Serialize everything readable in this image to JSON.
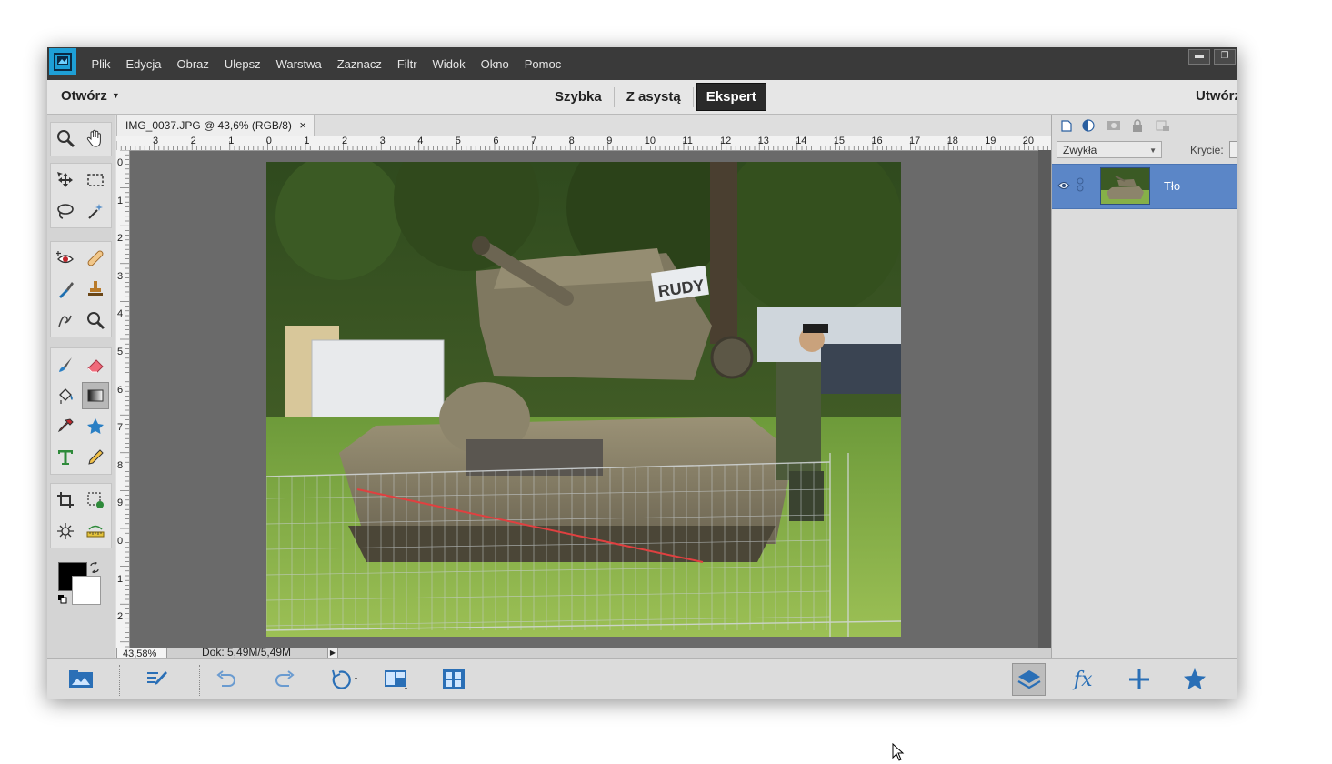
{
  "menu": {
    "items": [
      "Plik",
      "Edycja",
      "Obraz",
      "Ulepsz",
      "Warstwa",
      "Zaznacz",
      "Filtr",
      "Widok",
      "Okno",
      "Pomoc"
    ]
  },
  "window_controls": {
    "minimize": "▬",
    "restore": "❐"
  },
  "modebar": {
    "open_label": "Otwórz",
    "modes": [
      "Szybka",
      "Z asystą",
      "Ekspert"
    ],
    "active_mode": "Ekspert",
    "create_label": "Utwórz"
  },
  "tools": {
    "active": "gradient",
    "foreground_color": "#000000",
    "background_color": "#ffffff"
  },
  "document": {
    "tab_title": "IMG_0037.JPG @ 43,6% (RGB/8)",
    "close_glyph": "×",
    "ruler_h_labels": [
      "3",
      "2",
      "1",
      "0",
      "1",
      "2",
      "3",
      "4",
      "5",
      "6",
      "7",
      "8",
      "9",
      "10",
      "11",
      "12",
      "13",
      "14",
      "15",
      "16",
      "17",
      "18",
      "19",
      "20"
    ],
    "ruler_v_labels": [
      "0",
      "1",
      "2",
      "3",
      "4",
      "5",
      "6",
      "7",
      "8",
      "9",
      "0",
      "1",
      "2"
    ]
  },
  "status": {
    "zoom": "43,58%",
    "doc_size": "Dok: 5,49M/5,49M"
  },
  "layers_panel": {
    "blend_mode": "Zwykła",
    "opacity_label": "Krycie:",
    "layers": [
      {
        "name": "Tło",
        "visible": true,
        "selected": true
      }
    ]
  },
  "colors": {
    "titlebar": "#3a3a3a",
    "accent": "#1e9fd6",
    "layer_selected": "#5b86c7",
    "canvas_bg": "#6a6a6a"
  }
}
